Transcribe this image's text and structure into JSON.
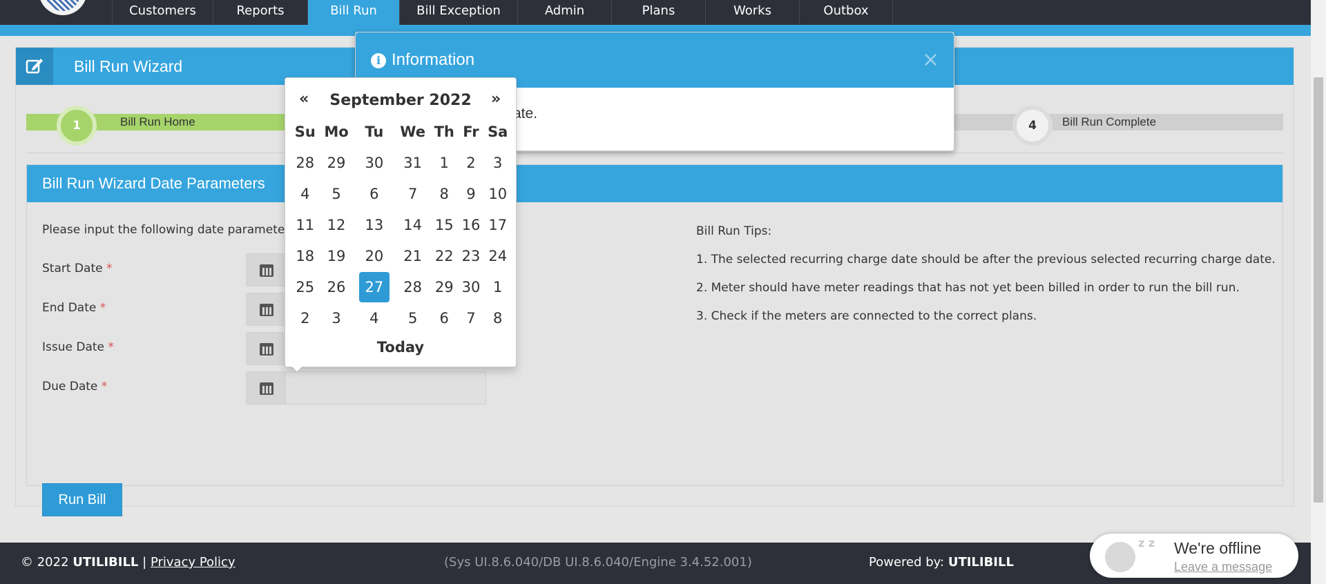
{
  "nav": {
    "items": [
      {
        "label": "Customers",
        "active": false
      },
      {
        "label": "Reports",
        "active": false
      },
      {
        "label": "Bill Run",
        "active": true
      },
      {
        "label": "Bill Exception",
        "active": false
      },
      {
        "label": "Admin",
        "active": false
      },
      {
        "label": "Plans",
        "active": false
      },
      {
        "label": "Works",
        "active": false
      },
      {
        "label": "Outbox",
        "active": false
      }
    ]
  },
  "wizard": {
    "title": "Bill Run Wizard",
    "steps": [
      {
        "number": "1",
        "label": "Bill Run Home"
      },
      {
        "number": "4",
        "label": "Bill Run Complete"
      }
    ]
  },
  "params": {
    "title": "Bill Run Wizard Date Parameters",
    "instruction": "Please input the following date parameters",
    "fields": [
      {
        "label": "Start Date",
        "value": ""
      },
      {
        "label": "End Date",
        "value": ""
      },
      {
        "label": "Issue Date",
        "value": ""
      },
      {
        "label": "Due Date",
        "value": ""
      }
    ],
    "required_marker": "*",
    "run_button": "Run Bill"
  },
  "tips": {
    "heading": "Bill Run Tips:",
    "items": [
      "1. The selected recurring charge date should be after the previous selected recurring charge date.",
      "2. Meter should have meter readings that has not yet been billed in order to run the bill run.",
      "3. Check if the meters are connected to the correct plans."
    ]
  },
  "modal": {
    "title": "Information",
    "message_visible": "ate.",
    "close": "×"
  },
  "datepicker": {
    "prev": "«",
    "next": "»",
    "month_label": "September 2022",
    "weekdays": [
      "Su",
      "Mo",
      "Tu",
      "We",
      "Th",
      "Fr",
      "Sa"
    ],
    "weeks": [
      [
        "28",
        "29",
        "30",
        "31",
        "1",
        "2",
        "3"
      ],
      [
        "4",
        "5",
        "6",
        "7",
        "8",
        "9",
        "10"
      ],
      [
        "11",
        "12",
        "13",
        "14",
        "15",
        "16",
        "17"
      ],
      [
        "18",
        "19",
        "20",
        "21",
        "22",
        "23",
        "24"
      ],
      [
        "25",
        "26",
        "27",
        "28",
        "29",
        "30",
        "1"
      ],
      [
        "2",
        "3",
        "4",
        "5",
        "6",
        "7",
        "8"
      ]
    ],
    "selected_day": "27",
    "today_label": "Today"
  },
  "footer": {
    "copyright": "© 2022",
    "brand": "UTILIBILL",
    "separator": "|",
    "privacy": "Privacy Policy",
    "version": "(Sys UI.8.6.040/DB UI.8.6.040/Engine 3.4.52.001)",
    "powered_by": "Powered by:",
    "powered_brand": "UTILIBILL"
  },
  "chat": {
    "status": "We're offline",
    "action": "Leave a message",
    "zz": "z z"
  },
  "colors": {
    "accent": "#36a5de",
    "nav_bg": "#2d3039",
    "step_done": "#a6d46b"
  }
}
